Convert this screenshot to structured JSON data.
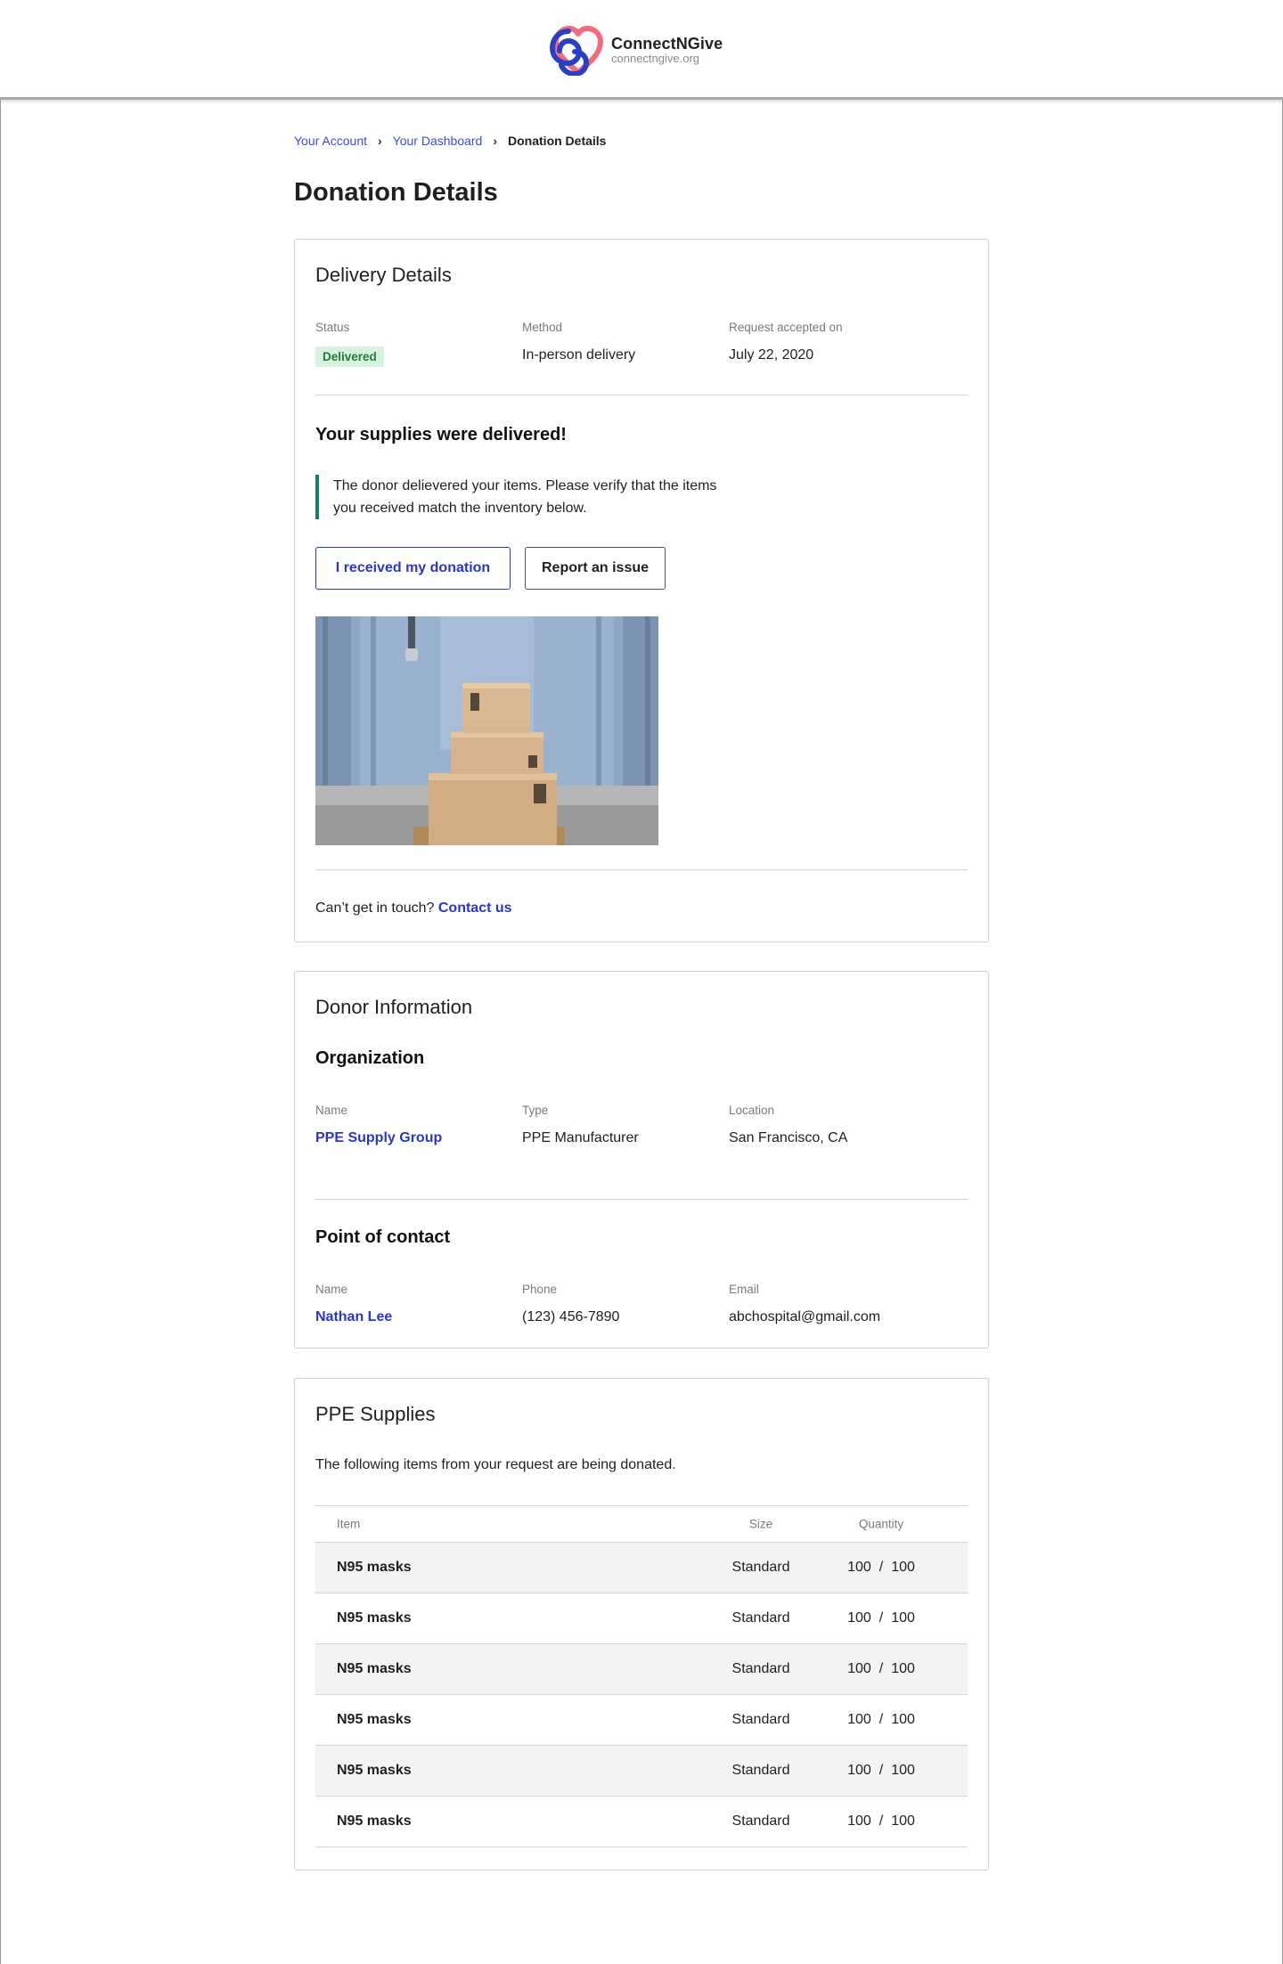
{
  "brand": {
    "name": "ConnectNGive",
    "url": "connectngive.org"
  },
  "breadcrumb": {
    "items": [
      "Your Account",
      "Your Dashboard"
    ],
    "current": "Donation Details"
  },
  "page": {
    "title": "Donation Details"
  },
  "delivery": {
    "title": "Delivery Details",
    "status_label": "Status",
    "status_value": "Delivered",
    "method_label": "Method",
    "method_value": "In-person delivery",
    "accepted_label": "Request accepted on",
    "accepted_value": "July 22, 2020",
    "headline": "Your supplies were delivered!",
    "notice_line1": "The donor delievered your items. Please verify that the items",
    "notice_line2": "you received match the inventory below.",
    "received_button": "I received my donation",
    "report_button": "Report an issue",
    "contact_prompt": "Can’t get in touch?",
    "contact_link": "Contact us"
  },
  "donor": {
    "title": "Donor Information",
    "organization_heading": "Organization",
    "org_name_label": "Name",
    "org_name_value": "PPE Supply Group",
    "org_type_label": "Type",
    "org_type_value": "PPE Manufacturer",
    "org_location_label": "Location",
    "org_location_value": "San Francisco, CA",
    "contact_heading": "Point of contact",
    "contact_name_label": "Name",
    "contact_name_value": "Nathan Lee",
    "contact_phone_label": "Phone",
    "contact_phone_value": "(123) 456-7890",
    "contact_email_label": "Email",
    "contact_email_value": "abchospital@gmail.com"
  },
  "supplies": {
    "title": "PPE Supplies",
    "intro": "The following items from your request are being donated.",
    "columns": {
      "item": "Item",
      "size": "Size",
      "quantity": "Quantity"
    },
    "rows": [
      {
        "item": "N95 masks",
        "size": "Standard",
        "received": "100",
        "requested": "100"
      },
      {
        "item": "N95 masks",
        "size": "Standard",
        "received": "100",
        "requested": "100"
      },
      {
        "item": "N95 masks",
        "size": "Standard",
        "received": "100",
        "requested": "100"
      },
      {
        "item": "N95 masks",
        "size": "Standard",
        "received": "100",
        "requested": "100"
      },
      {
        "item": "N95 masks",
        "size": "Standard",
        "received": "100",
        "requested": "100"
      },
      {
        "item": "N95 masks",
        "size": "Standard",
        "received": "100",
        "requested": "100"
      }
    ]
  },
  "colors": {
    "link": "#2b36c6",
    "badge_bg": "#d7f3de",
    "badge_text": "#1f7a3a",
    "notice_bar": "#1b7a6c",
    "logo_blue": "#2a3fc4",
    "logo_pink": "#f26a7e"
  }
}
